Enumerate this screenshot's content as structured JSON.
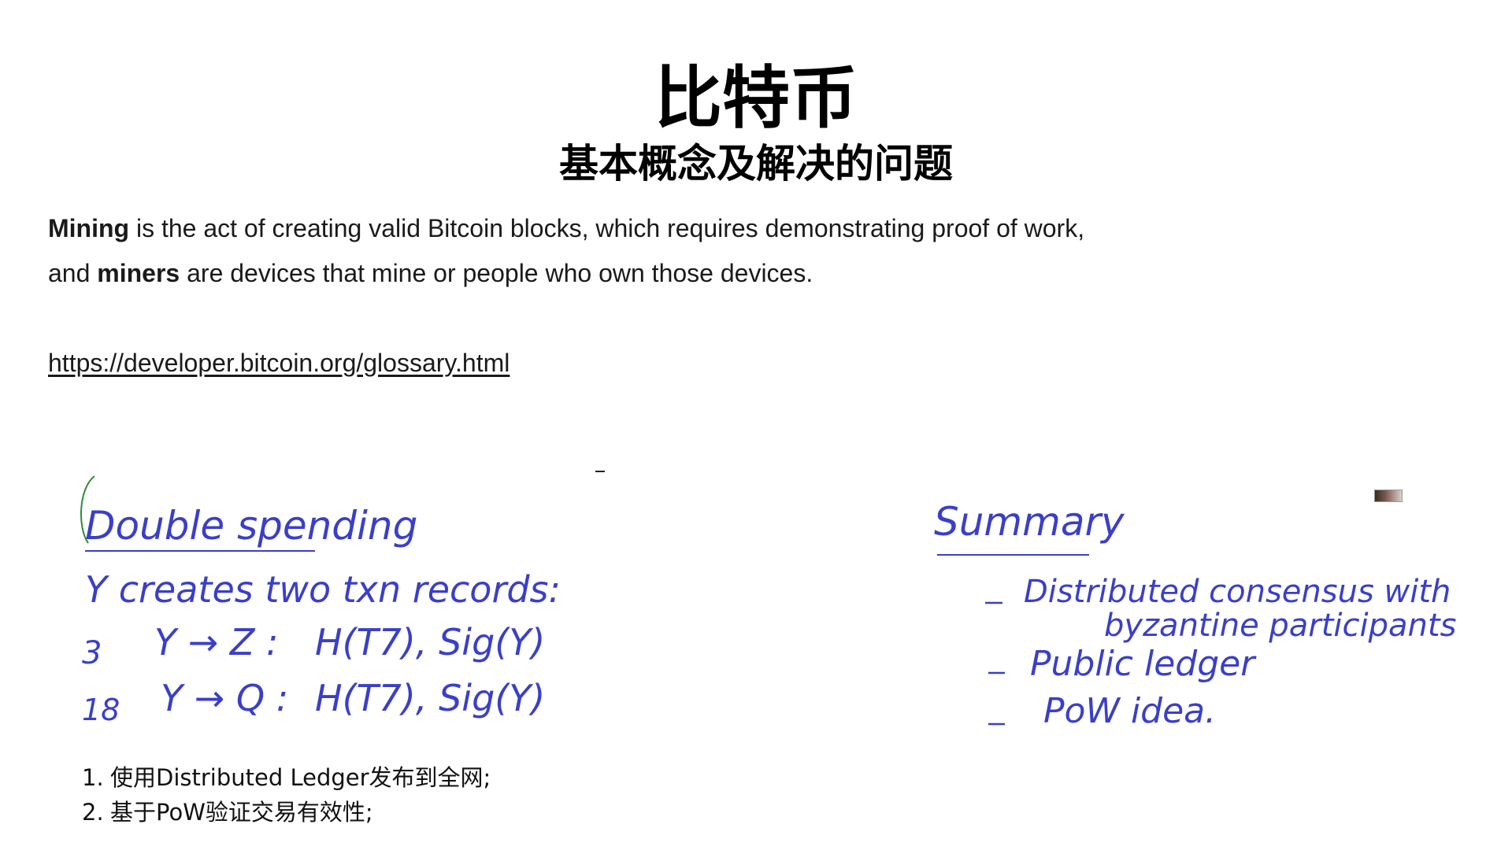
{
  "slide": {
    "title": "比特币",
    "subtitle": "基本概念及解决的问题",
    "definition": {
      "term1": "Mining",
      "text1": " is the act of creating valid Bitcoin blocks, which requires demonstrating proof of work,",
      "text2a": "and ",
      "term2": "miners",
      "text2b": " are devices that mine or people who own those devices."
    },
    "link": "https://developer.bitcoin.org/glossary.html",
    "handwriting": {
      "left": {
        "heading": "Double spending",
        "line1": "Y creates two txn records:",
        "line2a": "Y → Z :",
        "line2b": "H(T7), Sig(Y)",
        "line3a": "Y → Q :",
        "line3b": "H(T7), Sig(Y)",
        "margin1": "3",
        "margin2": "18"
      },
      "right": {
        "heading": "Summary",
        "items": [
          "Distributed consensus with",
          "byzantine participants",
          "Public ledger",
          "PoW idea."
        ]
      },
      "ink_color": "#3a3fc8",
      "accent_color": "#2e8b3a"
    },
    "steps": [
      {
        "num": "1.",
        "text": "使用Distributed Ledger发布到全网;"
      },
      {
        "num": "2.",
        "text": "基于PoW验证交易有效性;"
      }
    ]
  }
}
